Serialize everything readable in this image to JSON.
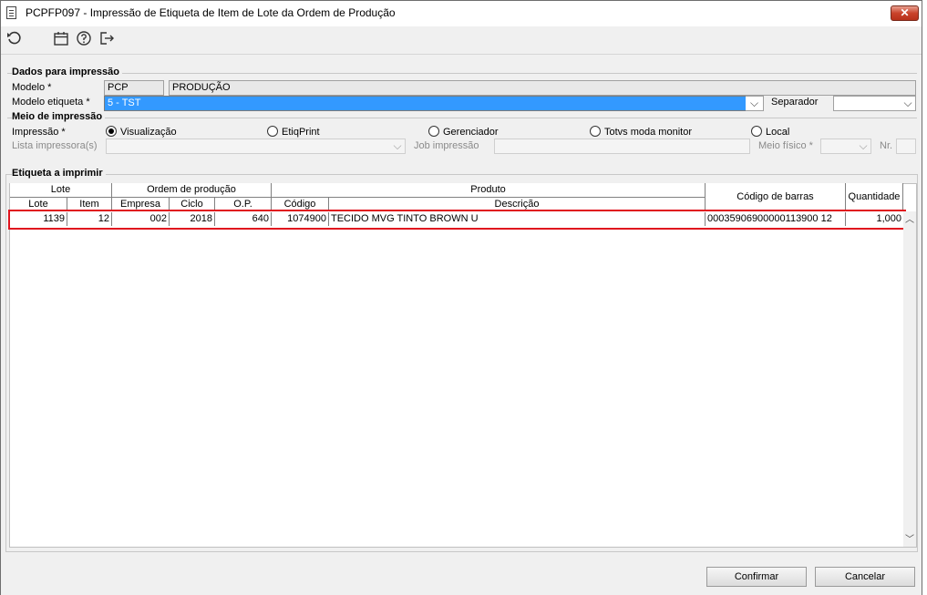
{
  "window": {
    "title": "PCPFP097 - Impressão de Etiqueta de Item de Lote da Ordem de Produção",
    "close_label": "✕"
  },
  "toolbar": {
    "icons": [
      "refresh-icon",
      "calendar-icon",
      "help-icon",
      "exit-icon"
    ]
  },
  "dados": {
    "section_title": "Dados para impressão",
    "modelo_label": "Modelo *",
    "modelo_code": "PCP",
    "modelo_desc": "PRODUÇÃO",
    "modelo_etiqueta_label": "Modelo etiqueta *",
    "modelo_etiqueta_value": "5 - TST",
    "separador_label": "Separador",
    "separador_value": ""
  },
  "meio": {
    "section_title": "Meio de impressão",
    "impressao_label": "Impressão *",
    "options": [
      {
        "label": "Visualização",
        "selected": true
      },
      {
        "label": "EtiqPrint",
        "selected": false
      },
      {
        "label": "Gerenciador",
        "selected": false
      },
      {
        "label": "Totvs moda monitor",
        "selected": false
      },
      {
        "label": "Local",
        "selected": false
      }
    ],
    "lista_label": "Lista impressora(s)",
    "job_label": "Job impressão",
    "meio_fisico_label": "Meio físico *",
    "nr_label": "Nr."
  },
  "etiqueta": {
    "section_title": "Etiqueta a imprimir",
    "groups": {
      "lote": "Lote",
      "ordem": "Ordem de produção",
      "produto": "Produto",
      "codigo_barras": "Código de barras",
      "quantidade": "Quantidade"
    },
    "columns": {
      "lote": "Lote",
      "item": "Item",
      "empresa": "Empresa",
      "ciclo": "Ciclo",
      "op": "O.P.",
      "codigo": "Código",
      "descricao": "Descrição"
    },
    "rows": [
      {
        "lote": "1139",
        "item": "12",
        "empresa": "002",
        "ciclo": "2018",
        "op": "640",
        "codigo": "1074900",
        "descricao": "TECIDO MVG TINTO BROWN U",
        "codigo_barras": "00035906900000113900 12",
        "quantidade": "1,000"
      }
    ]
  },
  "footer": {
    "confirmar": "Confirmar",
    "cancelar": "Cancelar"
  }
}
